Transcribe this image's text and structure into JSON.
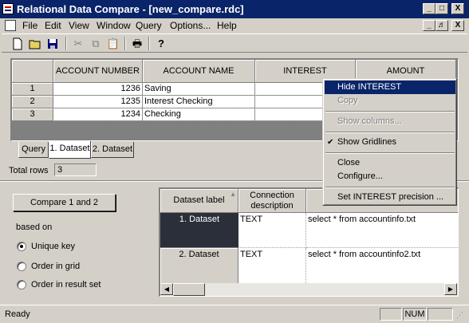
{
  "window": {
    "title": "Relational Data Compare - [new_compare.rdc]",
    "min_btn": "_",
    "max_btn": "□",
    "close_btn": "X",
    "mdi_min": "_",
    "mdi_restore": "♬",
    "mdi_close": "X"
  },
  "menu": [
    "File",
    "Edit",
    "View",
    "Window",
    "Query",
    "Options...",
    "Help"
  ],
  "toolbar": {
    "icons": [
      "new-document-icon",
      "open-folder-icon",
      "save-icon",
      "cut-icon",
      "copy-icon",
      "paste-icon",
      "print-icon",
      "help-icon"
    ]
  },
  "grid": {
    "columns": [
      "",
      "ACCOUNT NUMBER",
      "ACCOUNT NAME",
      "INTEREST",
      "AMOUNT"
    ],
    "rows": [
      {
        "rownum": "1",
        "account_number": "1236",
        "account_name": "Saving",
        "interest": "",
        "amount": ""
      },
      {
        "rownum": "2",
        "account_number": "1235",
        "account_name": "Interest Checking",
        "interest": "",
        "amount": ""
      },
      {
        "rownum": "3",
        "account_number": "1234",
        "account_name": "Checking",
        "interest": "",
        "amount": ""
      }
    ]
  },
  "tabs": [
    "Query",
    "1. Dataset",
    "2. Dataset"
  ],
  "total_rows": {
    "label": "Total rows",
    "value": "3"
  },
  "compare": {
    "button": "Compare 1 and 2",
    "based_on": "based on",
    "options": [
      "Unique key",
      "Order in grid",
      "Order in result set"
    ],
    "selected": "Unique key"
  },
  "datasets": {
    "headers": [
      "Dataset label",
      "Connection description",
      ""
    ],
    "rows": [
      {
        "label": "1. Dataset",
        "connection": "TEXT",
        "query": "select * from accountinfo.txt"
      },
      {
        "label": "2. Dataset",
        "connection": "TEXT",
        "query": "select * from accountinfo2.txt"
      }
    ]
  },
  "context_menu": {
    "items": [
      "Hide INTEREST",
      "Copy",
      "Show columns...",
      "Show Gridlines",
      "Close",
      "Configure...",
      "Set INTEREST precision ..."
    ],
    "checked_mark": "✔"
  },
  "status": {
    "text": "Ready",
    "num": "NUM"
  },
  "colors": {
    "titlebar": "#0a246a",
    "face": "#d4d0c8",
    "highlight": "#0a246a",
    "selected_cell": "#2a2f3a"
  }
}
